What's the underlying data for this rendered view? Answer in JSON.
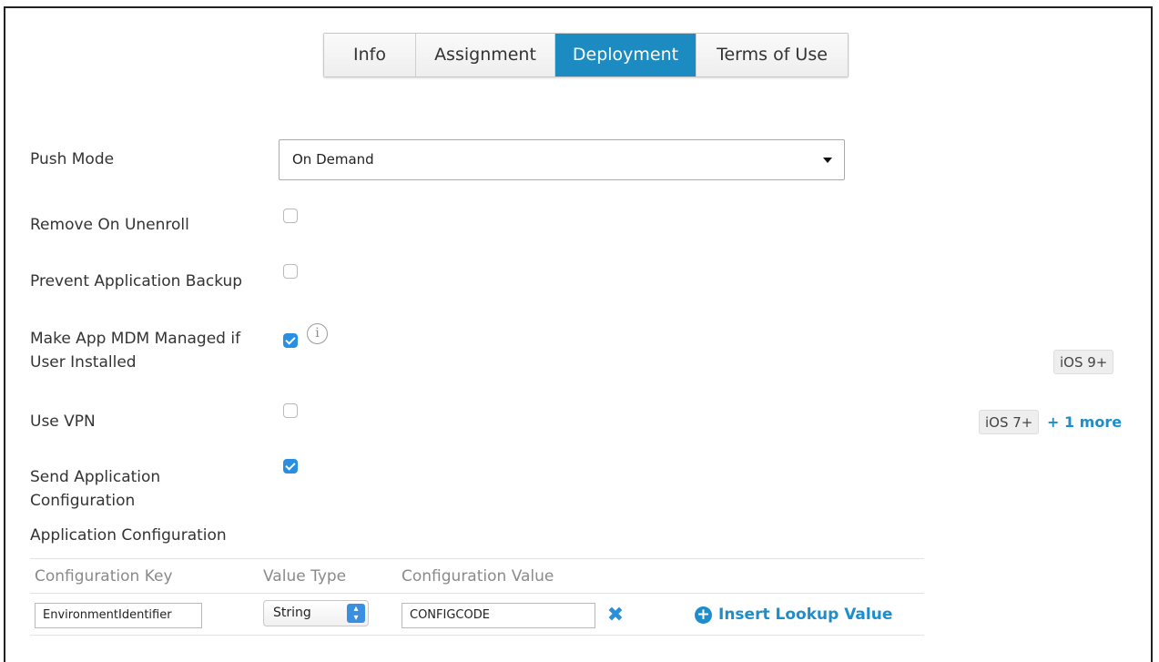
{
  "page": {
    "title": ""
  },
  "tabs": [
    {
      "label": "Info",
      "active": false
    },
    {
      "label": "Assignment",
      "active": false
    },
    {
      "label": "Deployment",
      "active": true
    },
    {
      "label": "Terms of Use",
      "active": false
    }
  ],
  "form": {
    "push_mode": {
      "label": "Push Mode",
      "value": "On Demand"
    },
    "remove_on_unenroll": {
      "label": "Remove On Unenroll",
      "checked": false
    },
    "prevent_backup": {
      "label": "Prevent Application Backup",
      "checked": false
    },
    "mdm_managed": {
      "label_line1": "Make App MDM Managed if",
      "label_line2": "User Installed",
      "checked": true,
      "badge": "iOS 9+"
    },
    "use_vpn": {
      "label": "Use VPN",
      "checked": false,
      "badge": "iOS 7+",
      "more": "+ 1 more"
    },
    "send_config": {
      "label_line1": "Send Application",
      "label_line2": "Configuration",
      "checked": true
    }
  },
  "app_config": {
    "section_label": "Application Configuration",
    "columns": [
      "Configuration Key",
      "Value Type",
      "Configuration Value"
    ],
    "rows": [
      {
        "key": "EnvironmentIdentifier",
        "type": "String",
        "value": "CONFIGCODE"
      }
    ],
    "insert_lookup_label": "Insert Lookup Value"
  },
  "colors": {
    "accent": "#1b8bc2",
    "checkbox_checked": "#2a8fe0",
    "link": "#1f8dc9"
  }
}
